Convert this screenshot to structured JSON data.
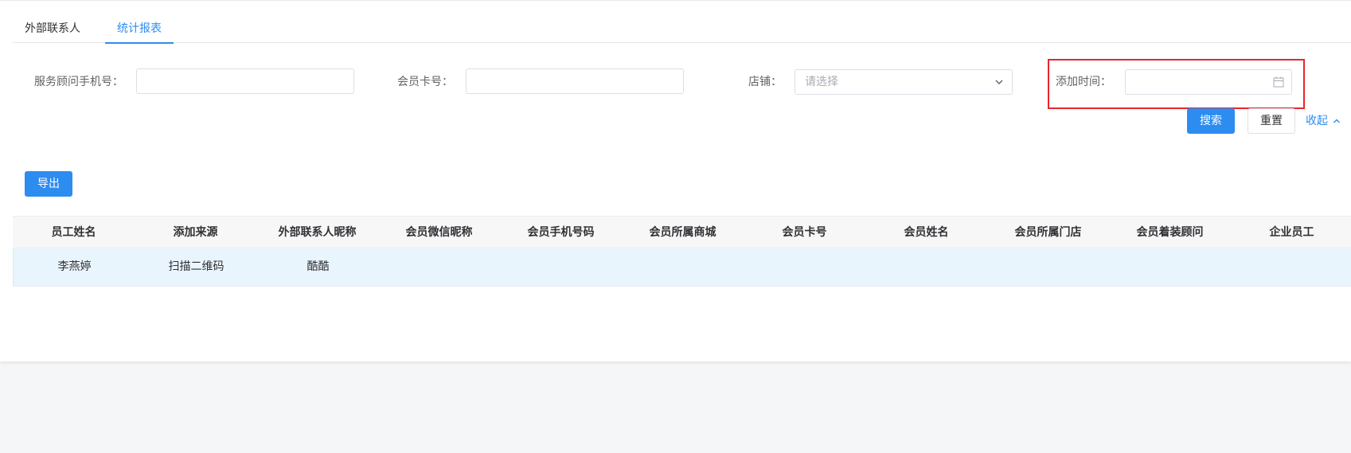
{
  "tabs": [
    {
      "label": "外部联系人",
      "active": false
    },
    {
      "label": "统计报表",
      "active": true
    }
  ],
  "filters": {
    "advisor_phone_label": "服务顾问手机号：",
    "advisor_phone_value": "",
    "card_no_label": "会员卡号：",
    "card_no_value": "",
    "store_label": "店铺：",
    "store_placeholder": "请选择",
    "add_time_label": "添加时间：",
    "add_time_value": ""
  },
  "actions": {
    "search_label": "搜索",
    "reset_label": "重置",
    "collapse_label": "收起",
    "export_label": "导出"
  },
  "table": {
    "columns": [
      "员工姓名",
      "添加来源",
      "外部联系人昵称",
      "会员微信昵称",
      "会员手机号码",
      "会员所属商城",
      "会员卡号",
      "会员姓名",
      "会员所属门店",
      "会员着装顾问",
      "企业员工"
    ],
    "rows": [
      [
        "李燕婷",
        "扫描二维码",
        "酷酷",
        "",
        "",
        "",
        "",
        "",
        "",
        "",
        ""
      ]
    ]
  },
  "colors": {
    "primary": "#2d8cf0",
    "highlight_border": "#e8262b",
    "selected_row_bg": "#e9f5fd"
  }
}
